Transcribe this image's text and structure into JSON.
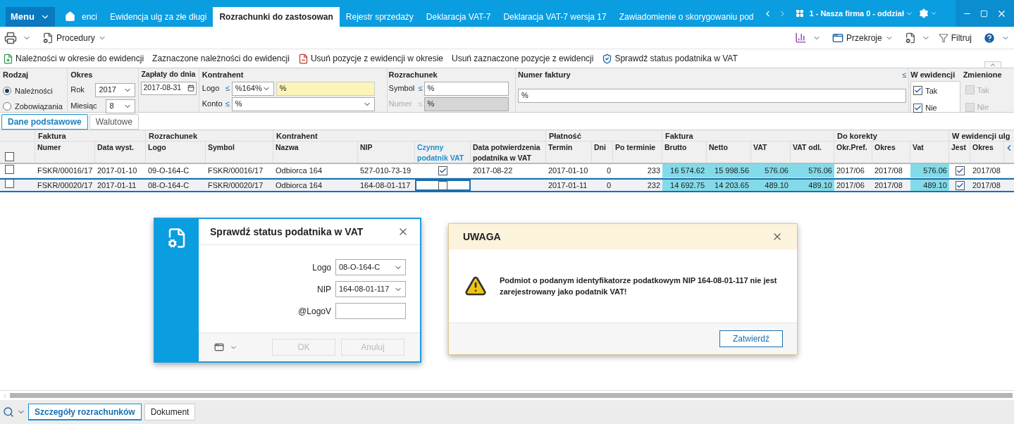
{
  "menu_button": {
    "label": "Menu"
  },
  "tabs": [
    {
      "label": "enci",
      "selected": false
    },
    {
      "label": "Ewidencja ulg za złe długi",
      "selected": false
    },
    {
      "label": "Rozrachunki do zastosowan",
      "selected": true
    },
    {
      "label": "Rejestr sprzedaży",
      "selected": false
    },
    {
      "label": "Deklaracja VAT-7",
      "selected": false
    },
    {
      "label": "Deklaracja VAT-7 wersja 17",
      "selected": false
    },
    {
      "label": "Zawiadomienie o skorygowaniu pod",
      "selected": false
    }
  ],
  "company": "1 - Nasza firma 0 - oddział",
  "toolbar": {
    "procedures": "Procedury",
    "views": "Przekroje",
    "filter": "Filtruj"
  },
  "actions": [
    {
      "label": "Należności w okresie do ewidencji",
      "kind": "add"
    },
    {
      "label": "Zaznaczone należności do ewidencji",
      "kind": "plain"
    },
    {
      "label": "Usuń pozycje z ewidencji w okresie",
      "kind": "remove"
    },
    {
      "label": "Usuń zaznaczone pozycje z ewidencji",
      "kind": "plain"
    },
    {
      "label": "Sprawdź status podatnika w VAT",
      "kind": "shield"
    }
  ],
  "filters": {
    "type": {
      "title": "Rodzaj",
      "options": [
        {
          "label": "Należności",
          "selected": true
        },
        {
          "label": "Zobowiązania",
          "selected": false
        }
      ]
    },
    "period": {
      "title": "Okres",
      "year_label": "Rok",
      "year": "2017",
      "month_label": "Miesiąc",
      "month": "8"
    },
    "paid_by": {
      "title": "Zapłaty do dnia",
      "value": "2017-08-31"
    },
    "contractor": {
      "title": "Kontrahent",
      "logo_label": "Logo",
      "logo_op": "≤",
      "logo": "%164%",
      "logo_text": "%",
      "account_label": "Konto",
      "account_op": "≤",
      "account": "%"
    },
    "settlement": {
      "title": "Rozrachunek",
      "symbol_label": "Symbol",
      "symbol_op": "≤",
      "symbol": "%",
      "number_label": "Numer",
      "number_op": "≤",
      "number": "%",
      "number_disabled": true
    },
    "invoice_number": {
      "title": "Numer faktury",
      "op": "≤",
      "value": "%"
    },
    "in_register": {
      "title": "W ewidencji",
      "options": [
        {
          "label": "Tak",
          "checked": true,
          "disabled": false
        },
        {
          "label": "Nie",
          "checked": true,
          "disabled": false
        }
      ]
    },
    "changed": {
      "title": "Zmienione",
      "options": [
        {
          "label": "Tak",
          "checked": false,
          "disabled": true
        },
        {
          "label": "Nie",
          "checked": false,
          "disabled": true
        }
      ]
    }
  },
  "view_tabs": [
    {
      "label": "Dane podstawowe",
      "selected": true
    },
    {
      "label": "Walutowe",
      "selected": false
    }
  ],
  "table": {
    "select_all": {
      "checked": false
    },
    "column_groups": [
      {
        "label": "Faktura",
        "columns": [
          {
            "label": "Numer",
            "kind": "text"
          },
          {
            "label": "Data wyst.",
            "kind": "text"
          }
        ]
      },
      {
        "label": "Rozrachunek",
        "columns": [
          {
            "label": "Logo",
            "kind": "text"
          },
          {
            "label": "Symbol",
            "kind": "text"
          }
        ]
      },
      {
        "label": "Kontrahent",
        "columns": [
          {
            "label": "Nazwa",
            "kind": "text"
          },
          {
            "label": "NIP",
            "kind": "text"
          },
          {
            "label": "Czynny podatnik VAT",
            "kind": "check",
            "selected": true
          },
          {
            "label": "Data potwierdzenia podatnika w VAT",
            "kind": "text"
          }
        ]
      },
      {
        "label": "Płatność",
        "columns": [
          {
            "label": "Termin",
            "kind": "text"
          },
          {
            "label": "Dni",
            "kind": "number"
          },
          {
            "label": "Po terminie",
            "kind": "number"
          }
        ]
      },
      {
        "label": "Faktura",
        "columns": [
          {
            "label": "Brutto",
            "kind": "amount"
          },
          {
            "label": "Netto",
            "kind": "amount"
          },
          {
            "label": "VAT",
            "kind": "amount"
          },
          {
            "label": "VAT odl.",
            "kind": "amount"
          }
        ]
      },
      {
        "label": "Do korekty",
        "columns": [
          {
            "label": "Okr.Pref.",
            "kind": "text"
          },
          {
            "label": "Okres",
            "kind": "text"
          },
          {
            "label": "Vat",
            "kind": "amount"
          }
        ]
      },
      {
        "label": "W ewidencji ulg",
        "columns": [
          {
            "label": "Jest",
            "kind": "check"
          },
          {
            "label": "Okres",
            "kind": "text"
          }
        ]
      }
    ],
    "rows": [
      {
        "checked": false,
        "selected": false,
        "cells": [
          "FSKR/00016/17",
          "2017-01-10",
          "09-O-164-C",
          "FSKR/00016/17",
          "Odbiorca 164",
          "527-010-73-19",
          {
            "checked": true
          },
          "2017-08-22",
          "2017-01-10",
          "0",
          "233",
          "16 574.62",
          "15 998.56",
          "576.06",
          "576.06",
          "2017/06",
          "2017/08",
          "576.06",
          {
            "checked": true
          },
          "2017/08"
        ]
      },
      {
        "checked": false,
        "selected": true,
        "cells": [
          "FSKR/00020/17",
          "2017-01-11",
          "08-O-164-C",
          "FSKR/00020/17",
          "Odbiorca 164",
          "164-08-01-117",
          {
            "checked": false
          },
          "",
          "2017-01-11",
          "0",
          "232",
          "14 692.75",
          "14 203.65",
          "489.10",
          "489.10",
          "2017/06",
          "2017/08",
          "489.10",
          {
            "checked": true
          },
          "2017/08"
        ]
      }
    ]
  },
  "check_dialog": {
    "title": "Sprawdź status podatnika w VAT",
    "fields": [
      {
        "label": "Logo",
        "value": "08-O-164-C",
        "kind": "select"
      },
      {
        "label": "NIP",
        "value": "164-08-01-117",
        "kind": "select"
      },
      {
        "label": "@LogoV",
        "kind": "text"
      }
    ],
    "buttons": [
      {
        "label": "OK",
        "disabled": true
      },
      {
        "label": "Anuluj",
        "disabled": true
      }
    ]
  },
  "alert": {
    "title": "UWAGA",
    "message": "Podmiot o podanym identyfikatorze podatkowym NIP 164-08-01-117 nie jest zarejestrowany jako podatnik VAT!",
    "button": "Zatwierdź"
  },
  "bottom_tabs": [
    {
      "label": "Szczegóły rozrachunków",
      "selected": true
    },
    {
      "label": "Dokument",
      "selected": false
    }
  ]
}
